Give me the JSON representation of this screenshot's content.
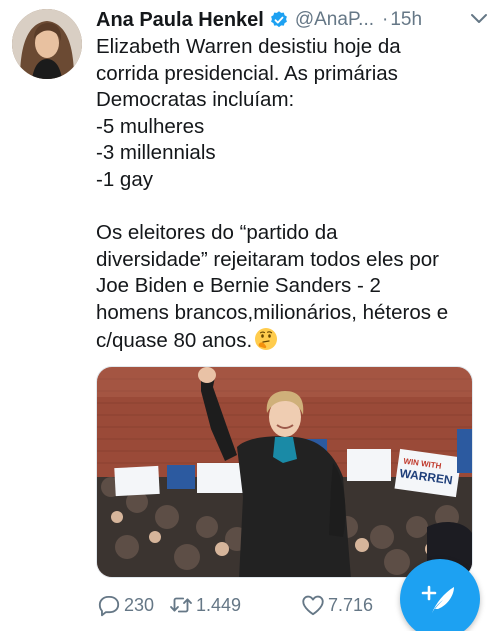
{
  "tweet": {
    "author_name": "Ana Paula Henkel",
    "handle": "@AnaP...",
    "separator": "·",
    "time": "15h",
    "text": "Elizabeth Warren desistiu hoje da\ncorrida presidencial. As primárias\nDemocratas incluíam:\n-5 mulheres\n-3 millennials\n-1 gay\n\nOs eleitores do “partido da\ndiversidade” rejeitaram todos eles por\nJoe Biden e Bernie Sanders - 2\nhomens brancos,milionários, héteros e\nc/quase 80 anos.",
    "emoji": "thinking-face",
    "photo": {
      "sign_line1": "WIN WITH",
      "sign_line2": "WARREN"
    }
  },
  "actions": {
    "replies": "230",
    "retweets": "1.449",
    "likes": "7.716"
  },
  "colors": {
    "accent": "#1da1f2",
    "secondary_text": "#657786",
    "primary_text": "#14171a"
  }
}
